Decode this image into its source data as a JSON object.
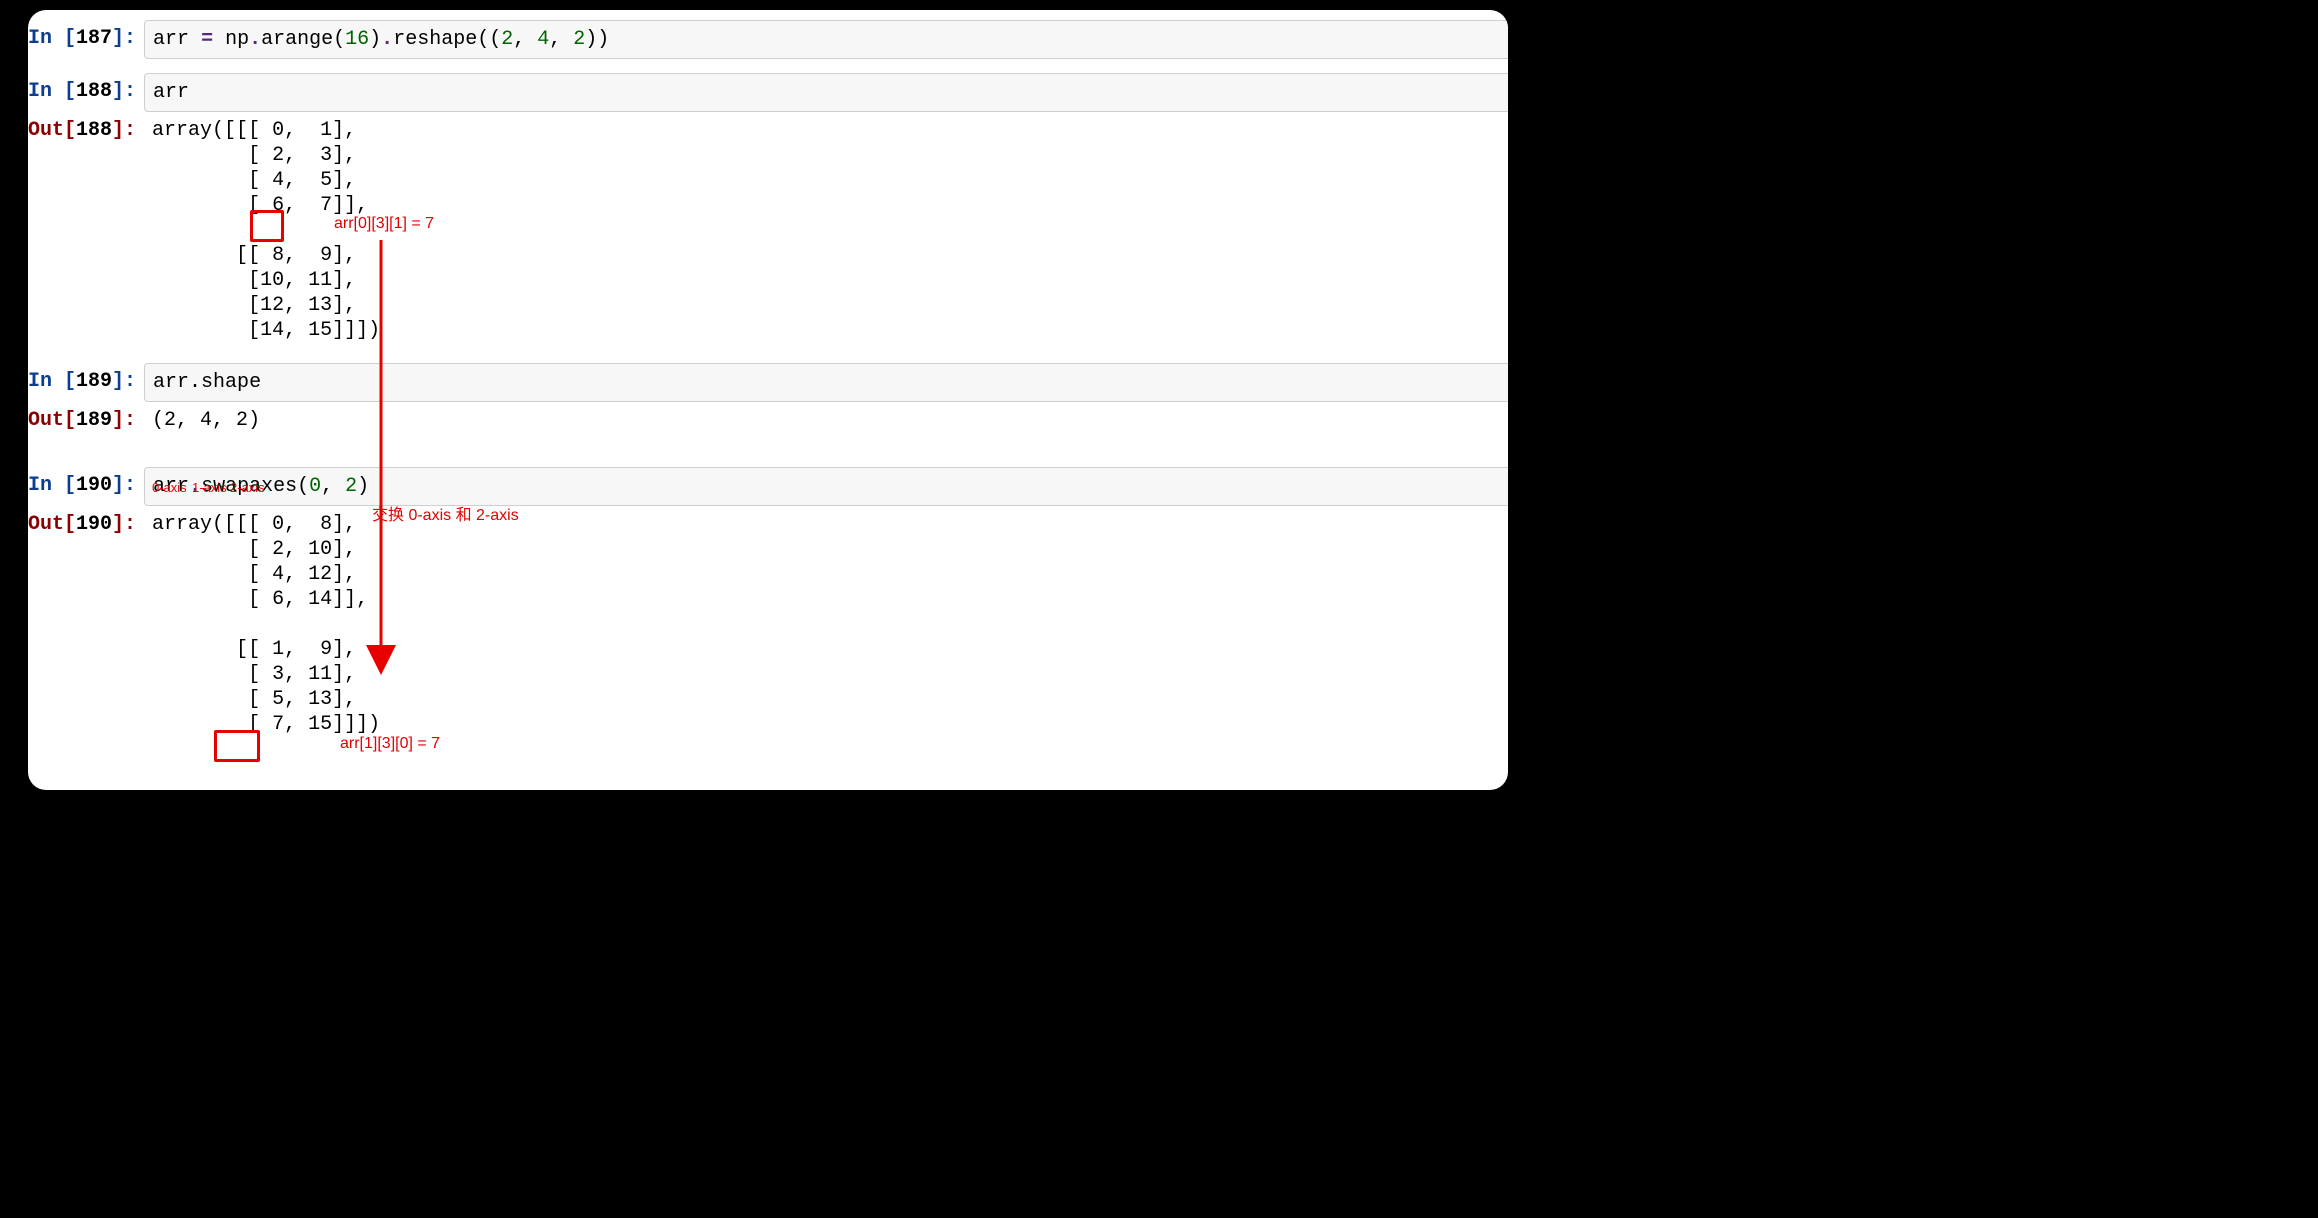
{
  "cells": {
    "c187": {
      "in_prefix": "In [",
      "in_num": "187",
      "in_suffix": "]:",
      "code": {
        "p1": "arr ",
        "op1": "=",
        "p2": " np",
        "dot1": ".",
        "fn1": "arange",
        "lp1": "(",
        "n16": "16",
        "rp1": ")",
        "dot2": ".",
        "fn2": "reshape",
        "lp2": "((",
        "n2a": "2",
        "c1": ", ",
        "n4": "4",
        "c2": ", ",
        "n2b": "2",
        "rp2": "))"
      }
    },
    "c188": {
      "in_prefix": "In [",
      "in_num": "188",
      "in_suffix": "]:",
      "out_prefix": "Out[",
      "out_num": "188",
      "out_suffix": "]:",
      "code": "arr",
      "output": "array([[[ 0,  1],\n        [ 2,  3],\n        [ 4,  5],\n        [ 6,  7]],\n\n       [[ 8,  9],\n        [10, 11],\n        [12, 13],\n        [14, 15]]])"
    },
    "c189": {
      "in_prefix": "In [",
      "in_num": "189",
      "in_suffix": "]:",
      "out_prefix": "Out[",
      "out_num": "189",
      "out_suffix": "]:",
      "code": "arr.shape",
      "output": "(2, 4, 2)"
    },
    "c190": {
      "in_prefix": "In [",
      "in_num": "190",
      "in_suffix": "]:",
      "out_prefix": "Out[",
      "out_num": "190",
      "out_suffix": "]:",
      "code": {
        "p1": "arr",
        "dot1": ".",
        "fn1": "swapaxes",
        "lp1": "(",
        "n0": "0",
        "c1": ", ",
        "n2": "2",
        "rp1": ")"
      },
      "output": "array([[[ 0,  8],\n        [ 2, 10],\n        [ 4, 12],\n        [ 6, 14]],\n\n       [[ 1,  9],\n        [ 3, 11],\n        [ 5, 13],\n        [ 7, 15]]])"
    }
  },
  "annotations": {
    "top_index": "arr[0][3][1] = 7",
    "axis0": "0-axis",
    "axis1": "1-axis",
    "axis2": "2-axis",
    "swap_note": "交换 0-axis 和 2-axis",
    "bottom_index": "arr[1][3][0] = 7"
  }
}
